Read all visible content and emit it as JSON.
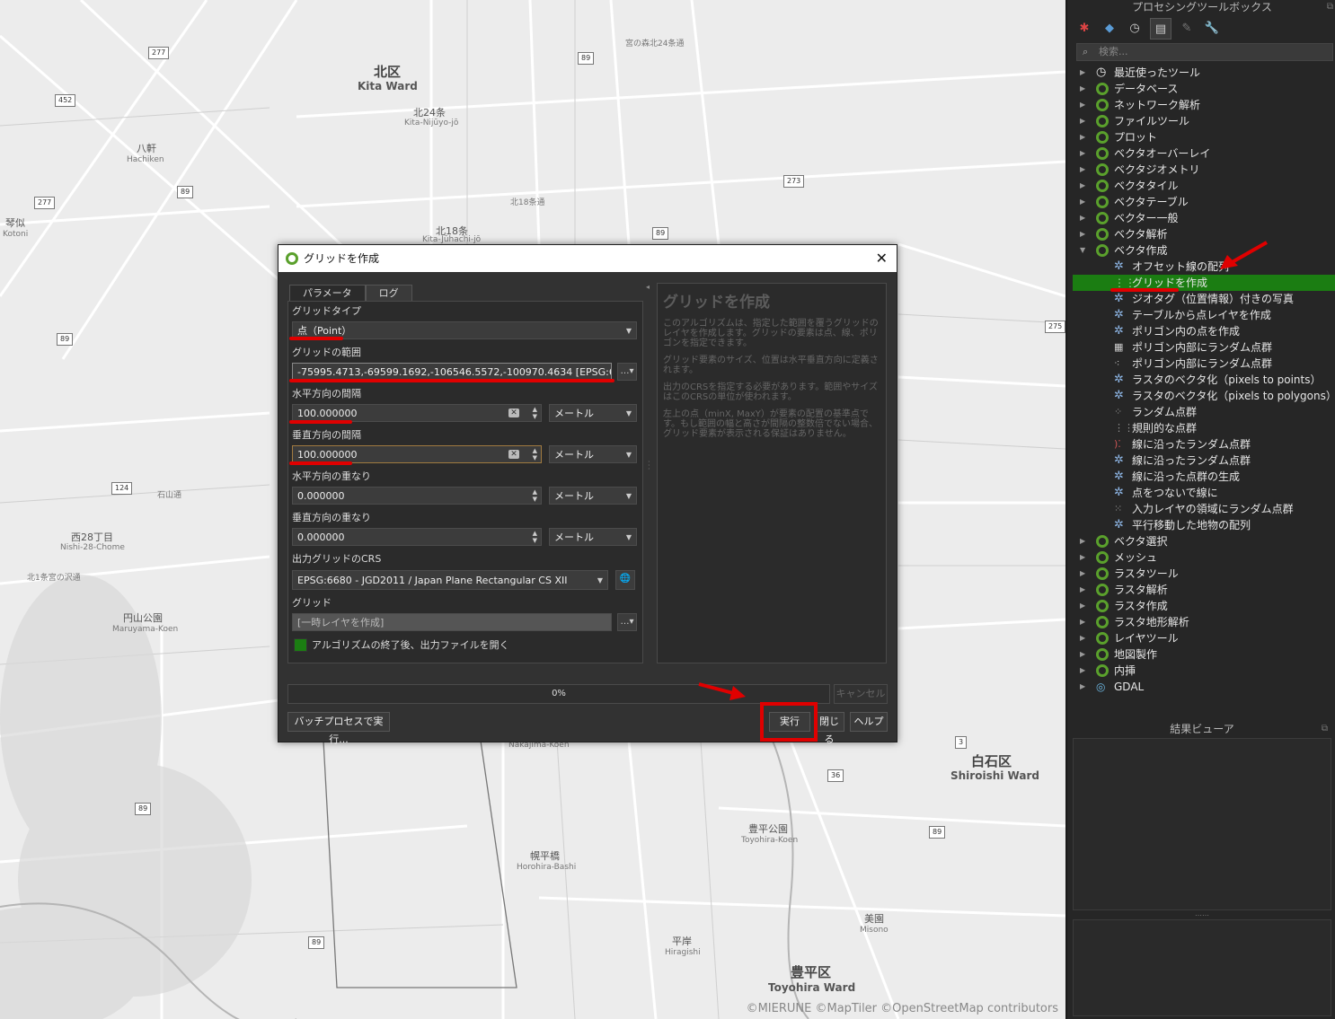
{
  "map": {
    "labels": {
      "kita_ward_jp": "北区",
      "kita_ward_en": "Kita Ward",
      "kita24_jp": "北24条",
      "kita24_en": "Kita-Nijūyo-jō",
      "kita18_jp": "北18条",
      "kita18_en": "Kita-Jūhachi-jō",
      "hachiken_jp": "八軒",
      "hachiken_en": "Hachiken",
      "kotoni_jp": "琴似",
      "kotoni_en": "Kotoni",
      "nishi28_jp": "西28丁目",
      "nishi28_en": "Nishi-28-Chome",
      "maruyama_jp": "円山公園",
      "maruyama_en": "Maruyama-Koen",
      "nakajima_en": "Nakajima-Koen",
      "horohira_jp": "幌平橋",
      "horohira_en": "Horohira-Bashi",
      "toyohira_park_jp": "豊平公園",
      "toyohira_park_en": "Toyohira-Koen",
      "hiragishi_jp": "平岸",
      "hiragishi_en": "Hiragishi",
      "misono_jp": "美園",
      "misono_en": "Misono",
      "shiroishi_jp": "白石区",
      "shiroishi_en": "Shiroishi Ward",
      "toyohira_jp": "豊平区",
      "toyohira_en": "Toyohira Ward",
      "street1": "北18条通",
      "street2": "北1条宮の沢通",
      "street3": "石山通",
      "street4": "宮の森北24条通"
    },
    "shields": [
      "277",
      "452",
      "89",
      "277",
      "89",
      "273",
      "89",
      "124",
      "89",
      "89",
      "3",
      "36",
      "89",
      "89",
      "275"
    ],
    "attribution": "©MIERUNE ©MapTiler ©OpenStreetMap contributors"
  },
  "panel": {
    "title": "プロセシングツールボックス",
    "search_placeholder": "検索...",
    "tree": [
      {
        "label": "最近使ったツール",
        "icon": "clock-icon",
        "expanded": false
      },
      {
        "label": "データベース",
        "icon": "qgis-icon",
        "expanded": false
      },
      {
        "label": "ネットワーク解析",
        "icon": "qgis-icon",
        "expanded": false
      },
      {
        "label": "ファイルツール",
        "icon": "qgis-icon",
        "expanded": false
      },
      {
        "label": "プロット",
        "icon": "qgis-icon",
        "expanded": false
      },
      {
        "label": "ベクタオーバーレイ",
        "icon": "qgis-icon",
        "expanded": false
      },
      {
        "label": "ベクタジオメトリ",
        "icon": "qgis-icon",
        "expanded": false
      },
      {
        "label": "ベクタタイル",
        "icon": "qgis-icon",
        "expanded": false
      },
      {
        "label": "ベクタテーブル",
        "icon": "qgis-icon",
        "expanded": false
      },
      {
        "label": "ベクター一般",
        "icon": "qgis-icon",
        "expanded": false
      },
      {
        "label": "ベクタ解析",
        "icon": "qgis-icon",
        "expanded": false
      },
      {
        "label": "ベクタ作成",
        "icon": "qgis-icon",
        "expanded": true
      }
    ],
    "children": [
      "オフセット線の配列",
      "グリッドを作成",
      "ジオタグ（位置情報）付きの写真",
      "テーブルから点レイヤを作成",
      "ポリゴン内の点を作成",
      "ポリゴン内部にランダム点群",
      "ポリゴン内部にランダム点群",
      "ラスタのベクタ化（pixels to points）",
      "ラスタのベクタ化（pixels to polygons）",
      "ランダム点群",
      "規則的な点群",
      "線に沿ったランダム点群",
      "線に沿ったランダム点群",
      "線に沿った点群の生成",
      "点をつないで線に",
      "入力レイヤの領域にランダム点群",
      "平行移動した地物の配列"
    ],
    "tree_after": [
      "ベクタ選択",
      "メッシュ",
      "ラスタツール",
      "ラスタ解析",
      "ラスタ作成",
      "ラスタ地形解析",
      "レイヤツール",
      "地図製作",
      "内挿",
      "GDAL"
    ],
    "results_title": "結果ビューア"
  },
  "dialog": {
    "title": "グリッドを作成",
    "tab_params": "パラメータ",
    "tab_log": "ログ",
    "grid_type_label": "グリッドタイプ",
    "grid_type_value": "点（Point）",
    "extent_label": "グリッドの範囲",
    "extent_value": "-75995.4713,-69599.1692,-106546.5572,-100970.4634 [EPSG:6680]",
    "hspacing_label": "水平方向の間隔",
    "hspacing_value": "100.000000",
    "vspacing_label": "垂直方向の間隔",
    "vspacing_value": "100.000000",
    "hoverlay_label": "水平方向の重なり",
    "hoverlay_value": "0.000000",
    "voverlay_label": "垂直方向の重なり",
    "voverlay_value": "0.000000",
    "unit": "メートル",
    "crs_label": "出力グリッドのCRS",
    "crs_value": "EPSG:6680 - JGD2011 / Japan Plane Rectangular CS XII",
    "grid_label": "グリッド",
    "grid_value": "[一時レイヤを作成]",
    "open_output_label": "アルゴリズムの終了後、出力ファイルを開く",
    "help_title": "グリッドを作成",
    "help_p1": "このアルゴリズムは、指定した範囲を覆うグリッドのレイヤを作成します。グリッドの要素は点、線、ポリゴンを指定できます。",
    "help_p2": "グリッド要素のサイズ、位置は水平垂直方向に定義されます。",
    "help_p3": "出力のCRSを指定する必要があります。範囲やサイズはこのCRSの単位が使われます。",
    "help_p4": "左上の点（minX, MaxY）が要素の配置の基準点です。もし範囲の幅と高さが間隔の整数倍でない場合、グリッド要素が表示される保証はありません。",
    "progress": "0%",
    "cancel": "キャンセル",
    "batch": "バッチプロセスで実行...",
    "run": "実行",
    "close": "閉じる",
    "help": "ヘルプ"
  },
  "colors": {
    "annotation": "#e00000",
    "selected": "#1b7d12",
    "qgis_green": "#5aa02c"
  }
}
